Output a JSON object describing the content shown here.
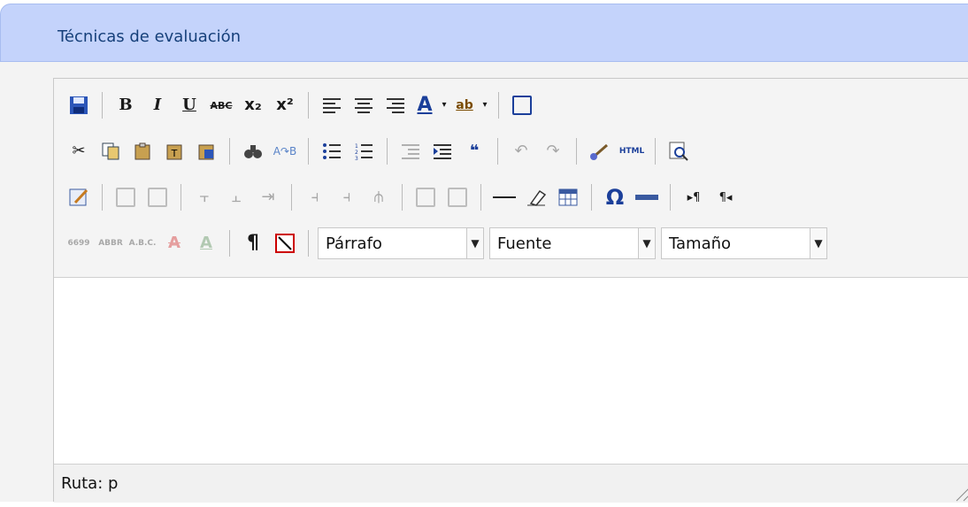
{
  "panel": {
    "title": "Técnicas de evaluación"
  },
  "toolbar": {
    "row1": {
      "bold": "B",
      "italic": "I",
      "underline": "U",
      "strike": "ABC",
      "subscript": "x₂",
      "superscript": "x²",
      "font_color": "A",
      "highlight": "ab"
    },
    "row2": {
      "blockquote": "❝",
      "html": "HTML"
    },
    "row3": {
      "omega": "Ω"
    },
    "row4": {
      "cite": "6699",
      "abbr": "ABBR",
      "acronym": "A.B.C.",
      "format_select": "Párrafo",
      "font_select": "Fuente",
      "size_select": "Tamaño"
    }
  },
  "statusbar": {
    "path": "Ruta: p"
  }
}
